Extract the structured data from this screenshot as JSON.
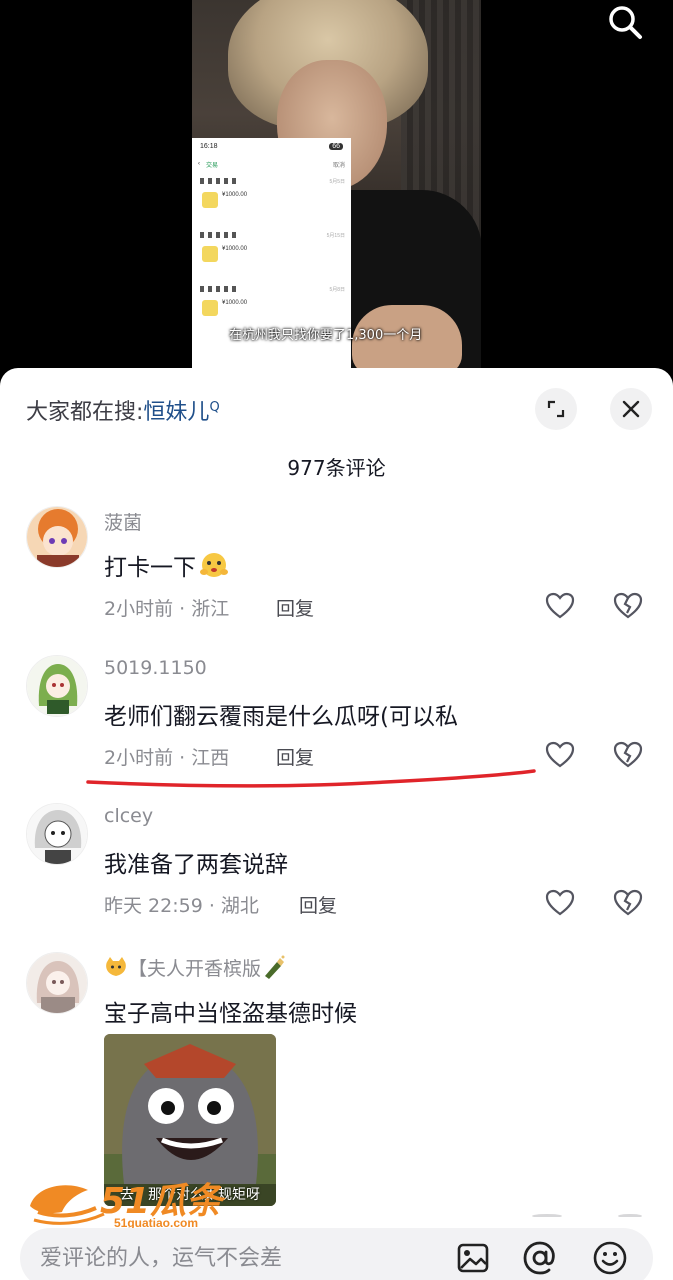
{
  "video": {
    "subtitle": "在杭州我只找你要了1,300一个月",
    "phone_screenshot": {
      "time": "16:18",
      "battery": "66",
      "nav_title": "交易",
      "cancel_label": "取消",
      "rows": [
        {
          "amount": "¥1000.00",
          "date": "5月5日"
        },
        {
          "amount": "¥1000.00",
          "date": "5月15日"
        },
        {
          "amount": "¥1000.00",
          "date": "5月8日"
        }
      ]
    }
  },
  "header": {
    "hot_search_prefix": "大家都在搜:",
    "hot_search_term": "恒妹儿",
    "comment_count": "977条评论"
  },
  "comments": [
    {
      "username": "菠菌",
      "text": "打卡一下",
      "meta": "2小时前 · 浙江",
      "reply": "回复"
    },
    {
      "username": "5019.1150",
      "text": "老师们翻云覆雨是什么瓜呀(可以私",
      "meta": "2小时前 · 江西",
      "reply": "回复"
    },
    {
      "username": "clcey",
      "text": "我准备了两套说辞",
      "meta": "昨天 22:59 · 湖北",
      "reply": "回复"
    },
    {
      "username": "【夫人开香槟版",
      "text": "宝子高中当怪盗基德时候",
      "sticker_caption": "去，那个对么太规矩呀"
    }
  ],
  "watermark": {
    "brand": "51瓜条",
    "domain": "51guatiao.com"
  },
  "input": {
    "placeholder": "爱评论的人，运气不会差"
  },
  "icons": {
    "search": "search-icon",
    "expand": "expand-icon",
    "close": "close-icon",
    "like": "heart-icon",
    "dislike": "broken-heart-icon",
    "image": "image-icon",
    "at": "at-icon",
    "emoji": "emoji-icon"
  },
  "colors": {
    "hot_search_term": "#1f4f8a",
    "annotation_underline": "#e0242a"
  }
}
